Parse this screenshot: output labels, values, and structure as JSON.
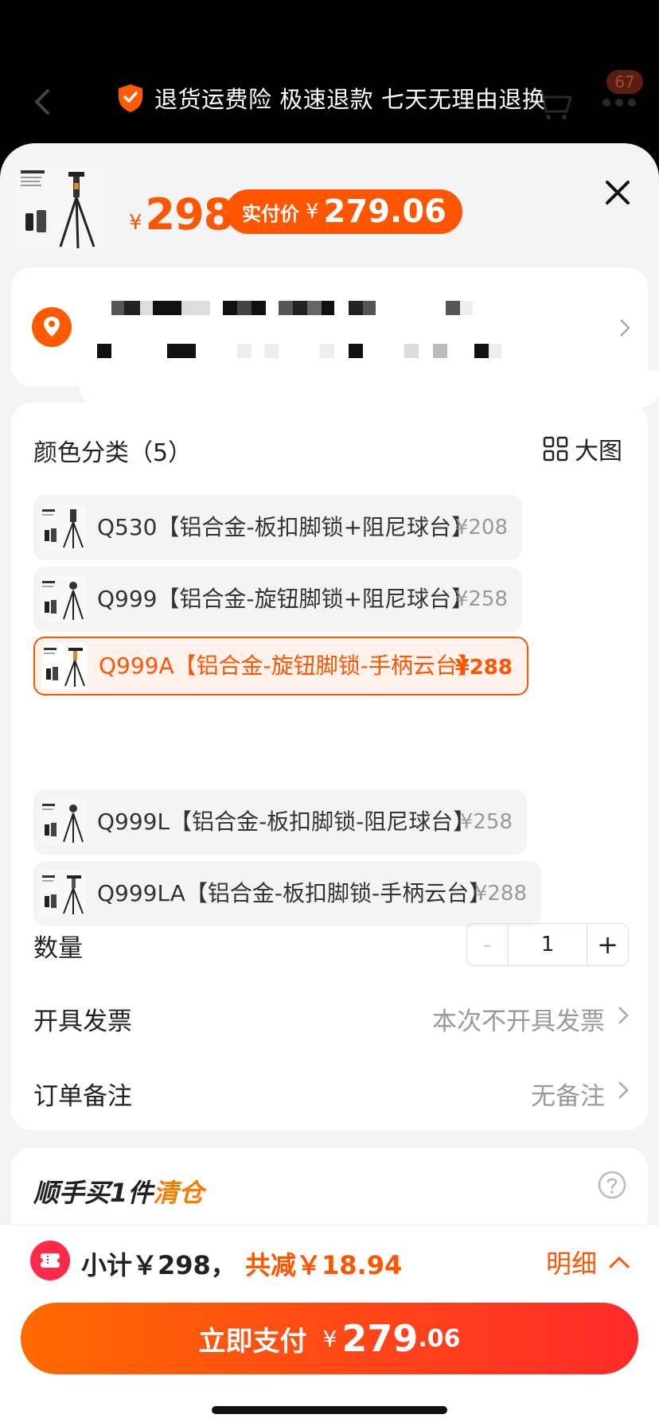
{
  "header": {
    "promo_text": "退货运费险 极速退款 七天无理由退换",
    "cart_badge": "67",
    "icons": [
      "back-icon",
      "shield-icon",
      "cart-icon",
      "more-icon"
    ]
  },
  "summary": {
    "currency": "¥",
    "price": "298",
    "real_price_label": "实付价",
    "real_price": "279.06"
  },
  "address": {
    "masked": true
  },
  "spec": {
    "title": "颜色分类（5）",
    "big_view": "大图",
    "options": [
      {
        "name": "Q530【铝合金-板扣脚锁+阻尼球台】",
        "price": "¥208",
        "selected": false
      },
      {
        "name": "Q999【铝合金-旋钮脚锁+阻尼球台】",
        "price": "¥258",
        "selected": false
      },
      {
        "name": "Q999A【铝合金-旋钮脚锁-手柄云台】",
        "price": "¥288",
        "selected": true
      },
      {
        "name": "Q999L【铝合金-板扣脚锁-阻尼球台】",
        "price": "¥258",
        "selected": false
      },
      {
        "name": "Q999LA【铝合金-板扣脚锁-手柄云台】",
        "price": "¥288",
        "selected": false
      }
    ],
    "quantity_label": "数量",
    "minus": "-",
    "quantity": "1",
    "plus": "+",
    "invoice_label": "开具发票",
    "invoice_value": "本次不开具发票",
    "note_label": "订单备注",
    "note_value": "无备注"
  },
  "addon": {
    "title_prefix": "顺手买1件",
    "title_highlight": "清仓"
  },
  "footer": {
    "subtotal": "小计￥298，",
    "discount": "共减￥18.94",
    "detail": "明细",
    "pay_label": "立即支付",
    "pay_currency": "¥",
    "pay_int": "279",
    "pay_dec": ".06"
  },
  "colors": {
    "accent": "#ff5500",
    "pay_gradient_end": "#ff2a2a"
  }
}
